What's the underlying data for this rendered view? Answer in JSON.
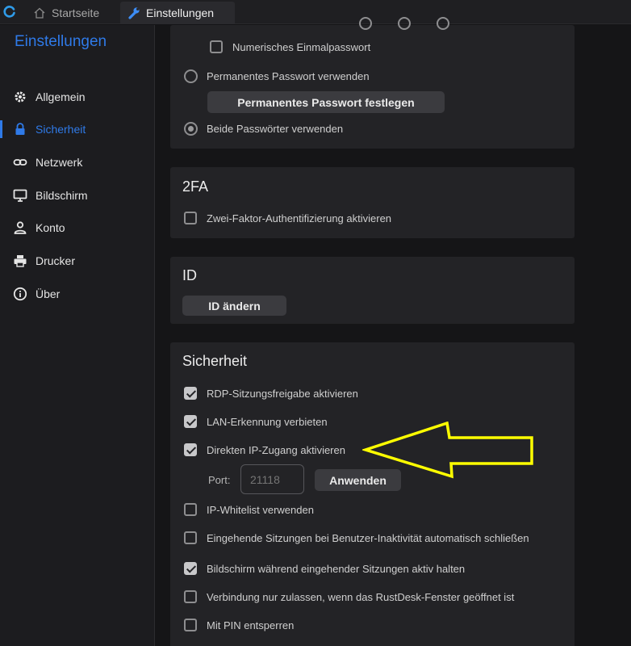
{
  "tabs": [
    {
      "label": "Startseite",
      "icon": "home-icon"
    },
    {
      "label": "Einstellungen",
      "icon": "wrench-icon"
    }
  ],
  "sidebar": {
    "title": "Einstellungen",
    "items": [
      {
        "label": "Allgemein",
        "icon": "gear-icon"
      },
      {
        "label": "Sicherheit",
        "icon": "lock-icon",
        "active": true
      },
      {
        "label": "Netzwerk",
        "icon": "link-icon"
      },
      {
        "label": "Bildschirm",
        "icon": "monitor-icon"
      },
      {
        "label": "Konto",
        "icon": "user-icon"
      },
      {
        "label": "Drucker",
        "icon": "printer-icon"
      },
      {
        "label": "Über",
        "icon": "info-icon"
      }
    ]
  },
  "password": {
    "otp_label": "Numerisches Einmalpasswort",
    "otp_checked": false,
    "permanent_radio": "Permanentes Passwort verwenden",
    "permanent_button": "Permanentes Passwort festlegen",
    "both_radio": "Beide Passwörter verwenden",
    "selected": "both"
  },
  "twofa": {
    "title": "2FA",
    "enable_label": "Zwei-Faktor-Authentifizierung aktivieren",
    "enabled": false
  },
  "id_section": {
    "title": "ID",
    "change_button": "ID ändern"
  },
  "security": {
    "title": "Sicherheit",
    "options": [
      {
        "label": "RDP-Sitzungsfreigabe aktivieren",
        "checked": true
      },
      {
        "label": "LAN-Erkennung verbieten",
        "checked": true
      },
      {
        "label": "Direkten IP-Zugang aktivieren",
        "checked": true
      },
      {
        "label": "IP-Whitelist verwenden",
        "checked": false
      },
      {
        "label": "Eingehende Sitzungen bei Benutzer-Inaktivität automatisch schließen",
        "checked": false
      },
      {
        "label": "Bildschirm während eingehender Sitzungen aktiv halten",
        "checked": true
      },
      {
        "label": "Verbindung nur zulassen, wenn das RustDesk-Fenster geöffnet ist",
        "checked": false
      },
      {
        "label": "Mit PIN entsperren",
        "checked": false
      }
    ],
    "port_label": "Port:",
    "port_placeholder": "21118",
    "apply_button": "Anwenden"
  },
  "colors": {
    "accent": "#2f7ae8",
    "annotation_arrow": "#ffff00",
    "background": "#151517",
    "card": "#232326"
  }
}
